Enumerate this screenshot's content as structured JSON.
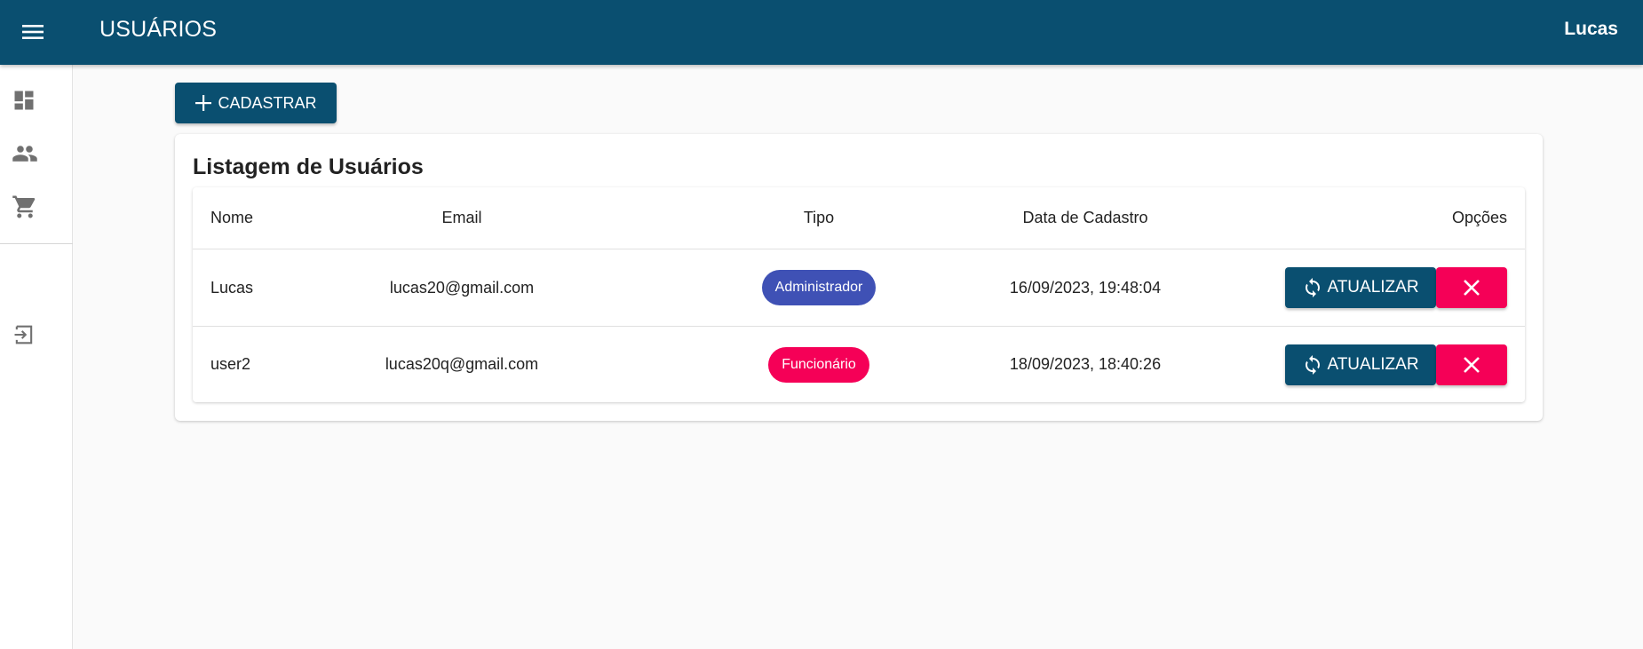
{
  "app": {
    "title": "USUÁRIOS",
    "user": "Lucas"
  },
  "sidebar": {
    "items": [
      {
        "name": "dashboard",
        "icon": "dashboard-icon"
      },
      {
        "name": "users",
        "icon": "people-icon"
      },
      {
        "name": "cart",
        "icon": "cart-icon"
      },
      {
        "name": "logout",
        "icon": "logout-icon"
      }
    ]
  },
  "toolbar": {
    "cadastrar_label": "CADASTRAR"
  },
  "card": {
    "title": "Listagem de Usuários"
  },
  "table": {
    "headers": {
      "nome": "Nome",
      "email": "Email",
      "tipo": "Tipo",
      "data": "Data de Cadastro",
      "opcoes": "Opções"
    },
    "rows": [
      {
        "nome": "Lucas",
        "email": "lucas20@gmail.com",
        "tipo": "Administrador",
        "tipo_color": "#3f51b5",
        "data": "16/09/2023, 19:48:04",
        "update_label": "ATUALIZAR"
      },
      {
        "nome": "user2",
        "email": "lucas20q@gmail.com",
        "tipo": "Funcionário",
        "tipo_color": "#f50057",
        "data": "18/09/2023, 18:40:26",
        "update_label": "ATUALIZAR"
      }
    ]
  },
  "colors": {
    "primary": "#0a4f70",
    "danger": "#f50057",
    "admin_chip": "#3f51b5"
  }
}
